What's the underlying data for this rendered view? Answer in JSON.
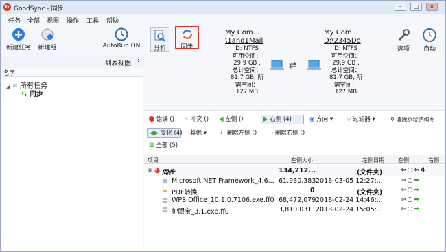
{
  "window": {
    "title": "GoodSync - 同步"
  },
  "menu": [
    "任务",
    "全部",
    "视图",
    "操作",
    "工具",
    "帮助"
  ],
  "left_toolbar": {
    "new_task": "新建任务",
    "new_group": "新建组",
    "autorun": "AutoRun ON"
  },
  "list_view": {
    "label": "列表视图",
    "chevron": "›"
  },
  "tree": {
    "header": "名字",
    "root": "所有任务",
    "child": "同步"
  },
  "toolbar": {
    "analyze": "分析",
    "sync": "同步",
    "options": "选项",
    "auto": "自动"
  },
  "left_folder": {
    "name": "My Com...",
    "path": "\\1and1Mail",
    "fs": "D: NTFS",
    "free_label": "可用空间：",
    "free": "29.9 GB ,",
    "total_label": "总计空间：",
    "total": "81.7 GB, 所",
    "need_label": "需空间：",
    "need": "127 MB"
  },
  "right_folder": {
    "name": "My Com...",
    "path": "D:\\2345Do",
    "fs": "D: NTFS",
    "free_label": "可用空间：",
    "free": "29.9 GB ,",
    "total_label": "总计空间：",
    "total": "81.7 GB, 所",
    "need_label": "需空间：",
    "need": "127 MB"
  },
  "filters": {
    "errors": "错误 ()",
    "conflicts": "冲突 ()",
    "left": "左侧 ()",
    "right": "右侧 (4)",
    "direction": "方向",
    "filter": "过滤器",
    "clear_tree": "清除树状结构图",
    "changes": "变化 (4)",
    "other": "其他",
    "del_left": "删除左侧 ()",
    "del_right": "删除右侧 ()",
    "all": "全部 (5)"
  },
  "columns": {
    "item": "项目",
    "left_size": "左侧大小",
    "left_date": "左侧日期",
    "left": "左侧",
    "right": "右侧"
  },
  "rows": [
    {
      "name": "同步",
      "size": "134,212...",
      "date": "(文件夹)",
      "extra": "4"
    },
    {
      "name": "Microsoft.NET Framework_4.6...",
      "size": "61,930,383",
      "date": "2018-03-05 12:27:..."
    },
    {
      "name": "PDF转换",
      "size": "0",
      "date": "(文件夹)"
    },
    {
      "name": "WPS Office_10.1.0.7106.exe.ff0",
      "size": "68,472,079",
      "date": "2018-02-24 14:46:..."
    },
    {
      "name": "护眼宝_3.1.exe.ff0",
      "size": "3,810,031",
      "date": "2018-02-24 15:05:..."
    }
  ],
  "colors": {
    "accent": "#e0322a",
    "blue": "#2f7bd8",
    "green": "#3aa52e"
  }
}
